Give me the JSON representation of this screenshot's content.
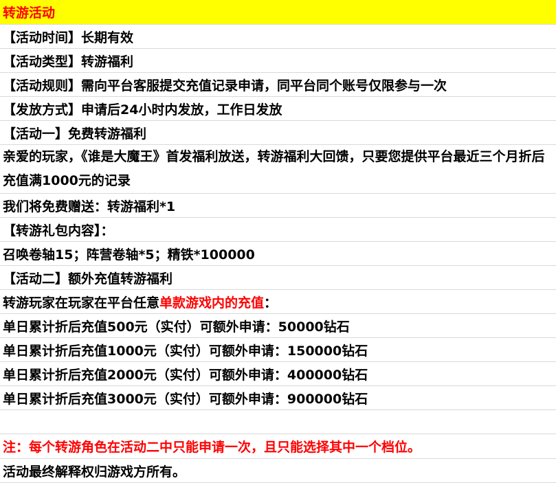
{
  "title": "转游活动",
  "rows": [
    "【活动时间】长期有效",
    "【活动类型】转游福利",
    "【活动规则】需向平台客服提交充值记录申请，同平台同个账号仅限参与一次",
    "【发放方式】申请后24小时内发放，工作日发放",
    "【活动一】免费转游福利",
    "亲爱的玩家，《谁是大魔王》首发福利放送，转游福利大回馈，只要您提供平台最近三个月折后充值满1000元的记录",
    "我们将免费赠送：转游福利*1",
    "【转游礼包内容】：",
    "召唤卷轴15；阵营卷轴*5；精铁*100000",
    "【活动二】额外充值转游福利"
  ],
  "activity2_intro": {
    "prefix": "转游玩家在玩家在平台任意",
    "highlight": "单款游戏内的充值",
    "suffix": "："
  },
  "tiers": [
    "单日累计折后充值500元（实付）可额外申请：50000钻石",
    "单日累计折后充值1000元（实付）可额外申请：150000钻石",
    "单日累计折后充值2000元（实付）可额外申请：400000钻石",
    "单日累计折后充值3000元（实付）可额外申请：900000钻石"
  ],
  "note": "注：每个转游角色在活动二中只能申请一次，且只能选择其中一个档位。",
  "footer": "活动最终解释权归游戏方所有。",
  "colors": {
    "title_bg": "#ffff00",
    "highlight": "#ff0000"
  }
}
